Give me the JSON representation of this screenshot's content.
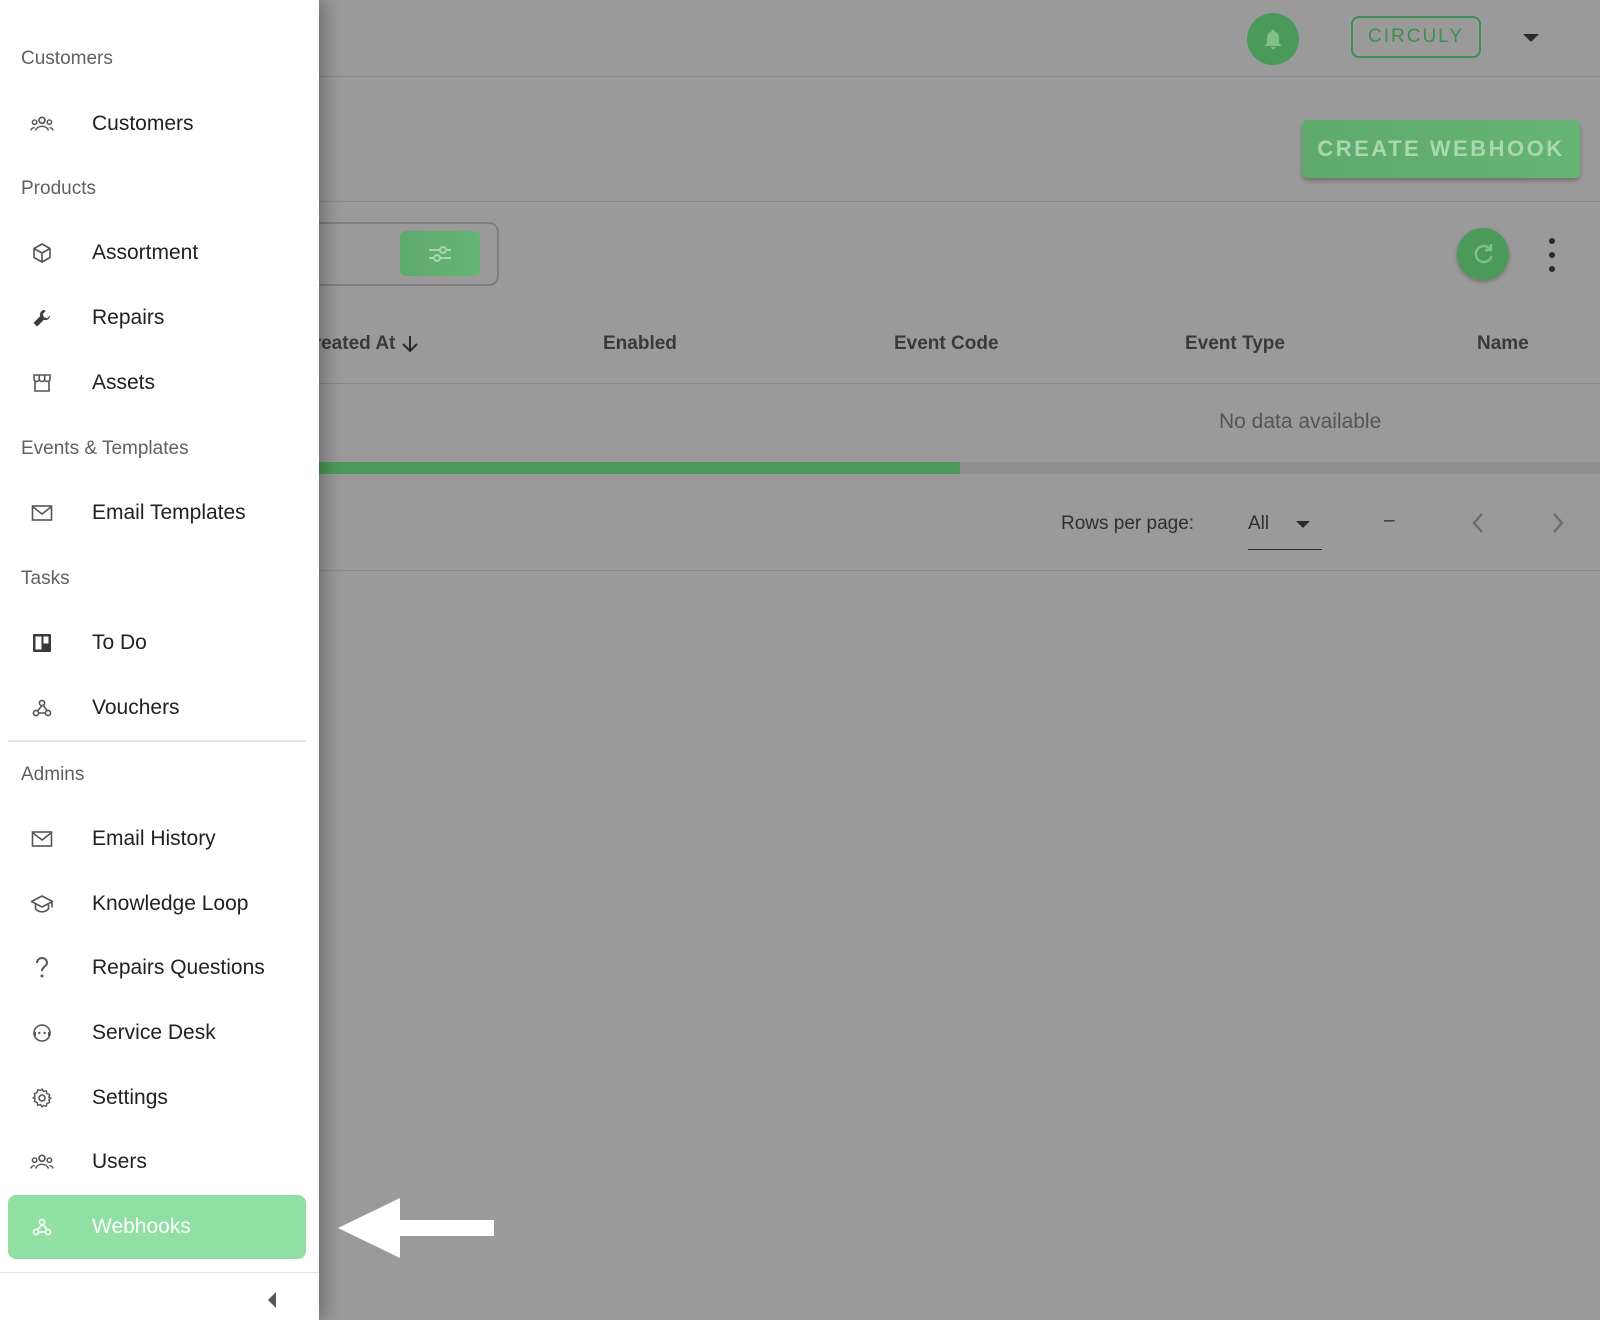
{
  "header": {
    "org_button": "CIRCULY"
  },
  "toolbar": {
    "create_button": "CREATE WEBHOOK"
  },
  "table": {
    "columns": [
      "Created At",
      "Enabled",
      "Event Code",
      "Event Type",
      "Name"
    ],
    "sort": {
      "column": "Created At",
      "direction": "descending"
    },
    "empty_text": "No data available",
    "loading_progress_percent": 60
  },
  "pagination": {
    "rows_per_page_label": "Rows per page:",
    "rows_per_page_value": "All",
    "range_text": "–"
  },
  "drawer": {
    "sections": [
      {
        "label": "Customers"
      },
      {
        "label": "Products"
      },
      {
        "label": "Events & Templates"
      },
      {
        "label": "Tasks"
      },
      {
        "label": "Admins"
      }
    ],
    "items": [
      {
        "label": "Customers",
        "icon": "users-icon"
      },
      {
        "label": "Assortment",
        "icon": "cube-icon"
      },
      {
        "label": "Repairs",
        "icon": "wrench-icon"
      },
      {
        "label": "Assets",
        "icon": "store-icon"
      },
      {
        "label": "Email Templates",
        "icon": "mail-icon"
      },
      {
        "label": "To Do",
        "icon": "board-icon"
      },
      {
        "label": "Vouchers",
        "icon": "webhook-icon"
      },
      {
        "label": "Email History",
        "icon": "mail-icon"
      },
      {
        "label": "Knowledge Loop",
        "icon": "graduation-cap-icon"
      },
      {
        "label": "Repairs Questions",
        "icon": "question-icon"
      },
      {
        "label": "Service Desk",
        "icon": "face-agent-icon"
      },
      {
        "label": "Settings",
        "icon": "gear-icon"
      },
      {
        "label": "Users",
        "icon": "users-icon"
      },
      {
        "label": "Webhooks",
        "icon": "webhook-icon",
        "active": true
      }
    ]
  },
  "colors": {
    "accent": "#8fe0a2",
    "primary_green": "#4c9a5a",
    "overlay": "#9a9a9a"
  }
}
